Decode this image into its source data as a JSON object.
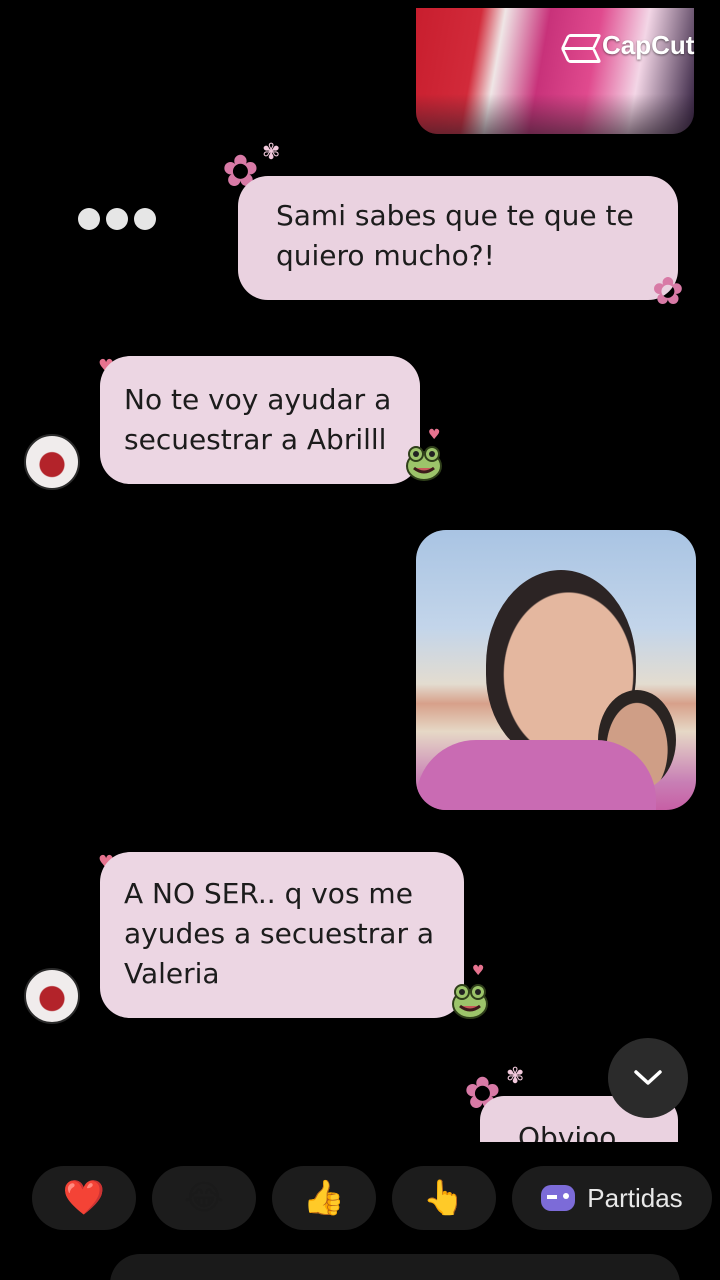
{
  "watermark": {
    "text": "CapCut"
  },
  "messages": {
    "sent_1": {
      "line1": "Sami sabes que te que te",
      "line2": "quiero mucho?!"
    },
    "received_1": {
      "line1": "No te voy ayudar a",
      "line2": "secuestrar a Abrilll"
    },
    "received_2": {
      "line1": "A NO SER.. q vos me",
      "line2": "ayudes a secuestrar a",
      "line3": "Valeria"
    },
    "sent_2_partial": {
      "text": "Obvioo"
    }
  },
  "reactions": {
    "heart": "❤️",
    "laugh": "😂",
    "thumbs_up": "👍",
    "pointing_hand": "👆",
    "partidas_label": "Partidas"
  },
  "icons": [
    "capcut-logo-icon",
    "typing-indicator-icon",
    "flower-icon",
    "frog-sticker-icon",
    "chevron-down-icon",
    "gamepad-icon"
  ]
}
